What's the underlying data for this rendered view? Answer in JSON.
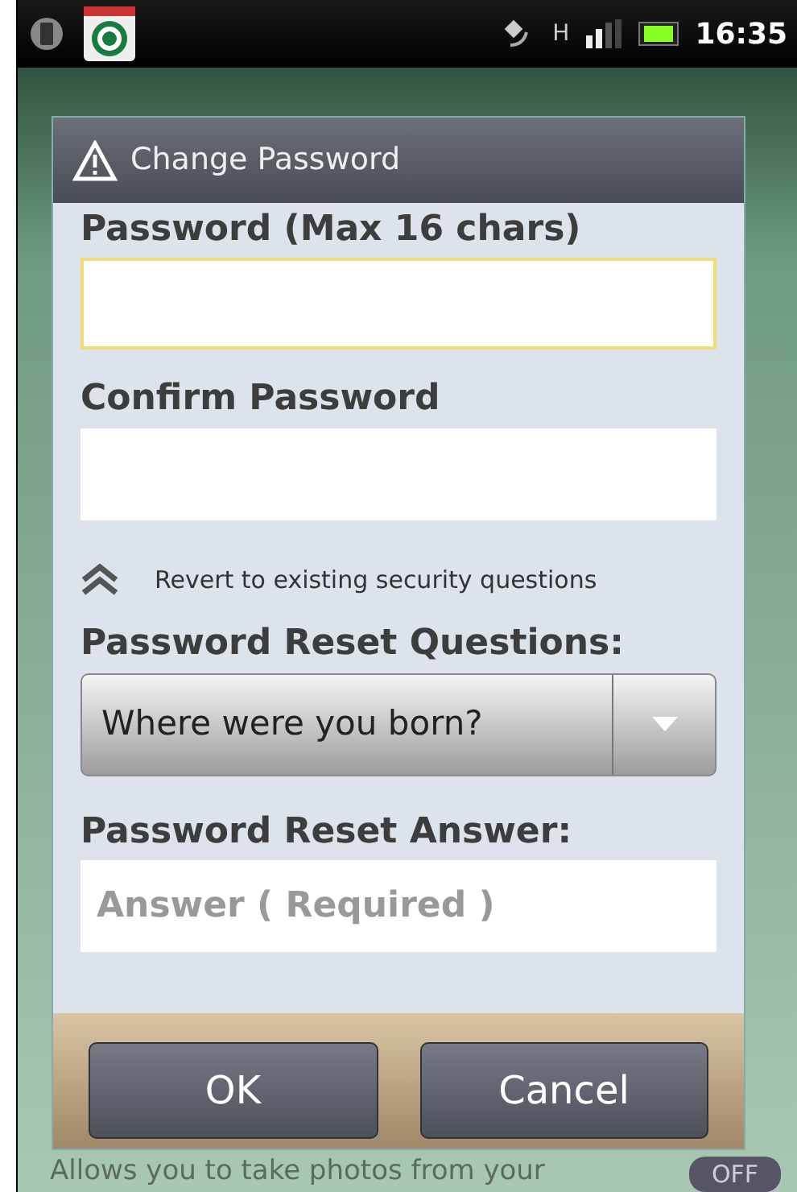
{
  "status_bar": {
    "network": "H",
    "time": "16:35"
  },
  "dialog": {
    "title": "Change Password",
    "fields": [
      {
        "kind": "input",
        "label": "Password (Max 16 chars)",
        "focused": true
      },
      {
        "kind": "input",
        "label": "Confirm Password",
        "focused": false
      },
      {
        "kind": "link",
        "text": "Revert to existing security questions"
      },
      {
        "kind": "select",
        "label": "Password Reset Questions:",
        "value": "Where were you born?"
      },
      {
        "kind": "input",
        "label": "Password Reset Answer:",
        "placeholder": "Answer ( Required )",
        "focused": false
      }
    ],
    "buttons": [
      "OK",
      "Cancel"
    ]
  },
  "background": {
    "text": "Allows you to take photos from your",
    "toggle": "OFF",
    "toggle_on": false
  }
}
